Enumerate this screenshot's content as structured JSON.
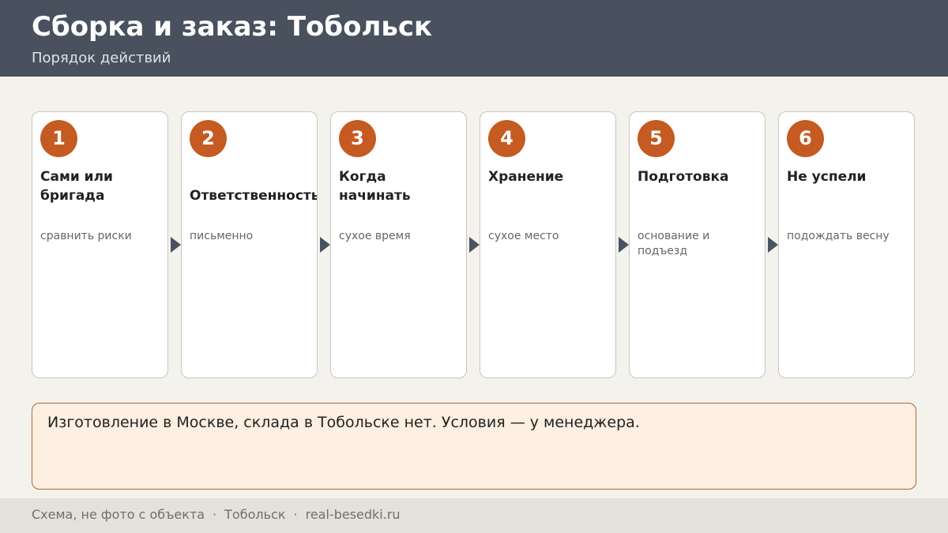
{
  "header": {
    "title": "Сборка и заказ: Тобольск",
    "subtitle": "Порядок действий"
  },
  "steps": [
    {
      "num": "1",
      "title": "Сами или бригада",
      "desc": "сравнить риски"
    },
    {
      "num": "2",
      "title": "Ответственность",
      "desc": "письменно"
    },
    {
      "num": "3",
      "title": "Когда начинать",
      "desc": "сухое время"
    },
    {
      "num": "4",
      "title": "Хранение",
      "desc": "сухое место"
    },
    {
      "num": "5",
      "title": "Подготовка",
      "desc": "основание и подъезд"
    },
    {
      "num": "6",
      "title": "Не успели",
      "desc": "подождать весну"
    }
  ],
  "note": {
    "text": "Изготовление в Москве, склада в Тобольске нет. Условия — у менеджера."
  },
  "footer": {
    "part1": "Схема, не фото с объекта",
    "separator": "·",
    "part2": "Тобольск",
    "part3": "real-besedki.ru"
  },
  "colors": {
    "header_bg": "#48515d",
    "accent": "#c55a22",
    "note_bg": "#fdefe1",
    "note_border": "#b06634"
  }
}
